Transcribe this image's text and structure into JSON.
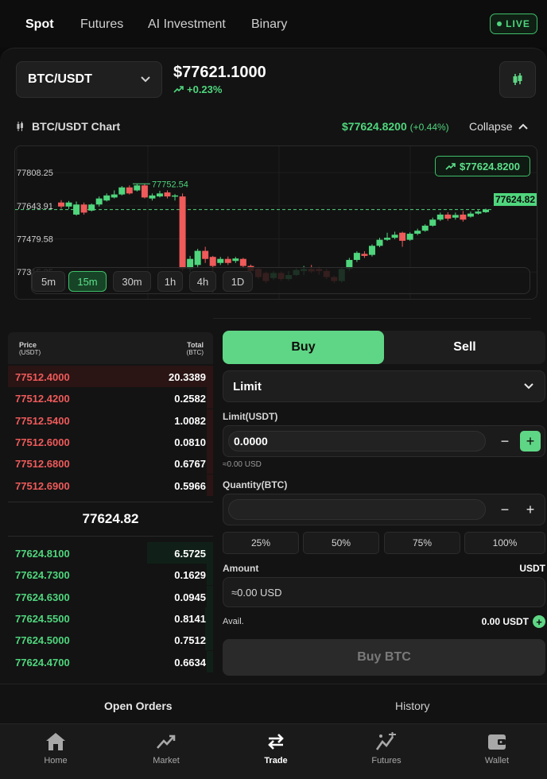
{
  "topnav": {
    "tabs": [
      "Spot",
      "Futures",
      "AI Investment",
      "Binary"
    ],
    "live_label": "LIVE"
  },
  "header": {
    "pair": "BTC/USDT",
    "price": "$77621.1000",
    "change": "+0.23%"
  },
  "chart_section": {
    "title": "BTC/USDT Chart",
    "price": "$77624.8200",
    "change_pct": "(+0.44%)",
    "collapse_label": "Collapse",
    "price_pill": "$77624.8200",
    "last_price_tag": "77624.82",
    "timeframes": [
      "5m",
      "15m",
      "30m",
      "1h",
      "4h",
      "1D"
    ],
    "active_timeframe": "15m"
  },
  "chart_data": {
    "type": "candlestick",
    "y_ticks": [
      "77808.25",
      "77643.91",
      "77479.58",
      "77315.25"
    ],
    "ylim": [
      77150,
      77880
    ],
    "high_annotation": "77752.54",
    "last_price": 77624.82,
    "candles": [
      {
        "o": 77660,
        "c": 77640,
        "h": 77672,
        "l": 77630
      },
      {
        "o": 77640,
        "c": 77660,
        "h": 77668,
        "l": 77628
      },
      {
        "o": 77600,
        "c": 77650,
        "h": 77665,
        "l": 77595
      },
      {
        "o": 77650,
        "c": 77610,
        "h": 77660,
        "l": 77600
      },
      {
        "o": 77620,
        "c": 77650,
        "h": 77655,
        "l": 77615
      },
      {
        "o": 77650,
        "c": 77680,
        "h": 77690,
        "l": 77640
      },
      {
        "o": 77670,
        "c": 77695,
        "h": 77705,
        "l": 77665
      },
      {
        "o": 77685,
        "c": 77700,
        "h": 77720,
        "l": 77680
      },
      {
        "o": 77700,
        "c": 77735,
        "h": 77742,
        "l": 77695
      },
      {
        "o": 77735,
        "c": 77705,
        "h": 77745,
        "l": 77700
      },
      {
        "o": 77720,
        "c": 77745,
        "h": 77752,
        "l": 77715
      },
      {
        "o": 77745,
        "c": 77685,
        "h": 77752,
        "l": 77680
      },
      {
        "o": 77680,
        "c": 77695,
        "h": 77705,
        "l": 77670
      },
      {
        "o": 77690,
        "c": 77705,
        "h": 77718,
        "l": 77685
      },
      {
        "o": 77710,
        "c": 77690,
        "h": 77720,
        "l": 77680
      },
      {
        "o": 77690,
        "c": 77695,
        "h": 77702,
        "l": 77670
      },
      {
        "o": 77690,
        "c": 77330,
        "h": 77705,
        "l": 77320
      },
      {
        "o": 77330,
        "c": 77380,
        "h": 77395,
        "l": 77315
      },
      {
        "o": 77350,
        "c": 77420,
        "h": 77430,
        "l": 77340
      },
      {
        "o": 77420,
        "c": 77380,
        "h": 77440,
        "l": 77360
      },
      {
        "o": 77390,
        "c": 77345,
        "h": 77395,
        "l": 77210
      },
      {
        "o": 77360,
        "c": 77380,
        "h": 77390,
        "l": 77350
      },
      {
        "o": 77380,
        "c": 77360,
        "h": 77392,
        "l": 77350
      },
      {
        "o": 77370,
        "c": 77382,
        "h": 77390,
        "l": 77360
      },
      {
        "o": 77380,
        "c": 77345,
        "h": 77385,
        "l": 77335
      },
      {
        "o": 77345,
        "c": 77320,
        "h": 77352,
        "l": 77310
      },
      {
        "o": 77330,
        "c": 77290,
        "h": 77338,
        "l": 77280
      },
      {
        "o": 77310,
        "c": 77270,
        "h": 77318,
        "l": 77260
      },
      {
        "o": 77285,
        "c": 77310,
        "h": 77320,
        "l": 77275
      },
      {
        "o": 77310,
        "c": 77280,
        "h": 77318,
        "l": 77270
      },
      {
        "o": 77280,
        "c": 77300,
        "h": 77320,
        "l": 77272
      },
      {
        "o": 77300,
        "c": 77325,
        "h": 77335,
        "l": 77295
      },
      {
        "o": 77320,
        "c": 77330,
        "h": 77345,
        "l": 77300
      },
      {
        "o": 77330,
        "c": 77318,
        "h": 77350,
        "l": 77310
      },
      {
        "o": 77330,
        "c": 77320,
        "h": 77340,
        "l": 77300
      },
      {
        "o": 77320,
        "c": 77290,
        "h": 77332,
        "l": 77280
      },
      {
        "o": 77290,
        "c": 77270,
        "h": 77298,
        "l": 77260
      },
      {
        "o": 77270,
        "c": 77330,
        "h": 77338,
        "l": 77262
      },
      {
        "o": 77330,
        "c": 77375,
        "h": 77385,
        "l": 77320
      },
      {
        "o": 77375,
        "c": 77410,
        "h": 77418,
        "l": 77365
      },
      {
        "o": 77405,
        "c": 77395,
        "h": 77418,
        "l": 77385
      },
      {
        "o": 77400,
        "c": 77445,
        "h": 77452,
        "l": 77392
      },
      {
        "o": 77445,
        "c": 77475,
        "h": 77485,
        "l": 77438
      },
      {
        "o": 77475,
        "c": 77485,
        "h": 77510,
        "l": 77470
      },
      {
        "o": 77485,
        "c": 77500,
        "h": 77515,
        "l": 77478
      },
      {
        "o": 77510,
        "c": 77470,
        "h": 77515,
        "l": 77440
      },
      {
        "o": 77475,
        "c": 77505,
        "h": 77512,
        "l": 77470
      },
      {
        "o": 77505,
        "c": 77520,
        "h": 77530,
        "l": 77498
      },
      {
        "o": 77520,
        "c": 77545,
        "h": 77552,
        "l": 77515
      },
      {
        "o": 77545,
        "c": 77575,
        "h": 77585,
        "l": 77540
      },
      {
        "o": 77575,
        "c": 77600,
        "h": 77610,
        "l": 77568
      },
      {
        "o": 77600,
        "c": 77580,
        "h": 77612,
        "l": 77570
      },
      {
        "o": 77585,
        "c": 77598,
        "h": 77610,
        "l": 77575
      },
      {
        "o": 77600,
        "c": 77575,
        "h": 77618,
        "l": 77565
      },
      {
        "o": 77590,
        "c": 77605,
        "h": 77615,
        "l": 77585
      },
      {
        "o": 77605,
        "c": 77615,
        "h": 77622,
        "l": 77600
      },
      {
        "o": 77612,
        "c": 77625,
        "h": 77630,
        "l": 77608
      }
    ]
  },
  "orderbook": {
    "col_price": "Price",
    "col_price_unit": "(USDT)",
    "col_total": "Total",
    "col_total_unit": "(BTC)",
    "asks": [
      {
        "price": "77512.4000",
        "total": "20.3389",
        "depth": 1.0
      },
      {
        "price": "77512.4200",
        "total": "0.2582",
        "depth": 0.03
      },
      {
        "price": "77512.5400",
        "total": "1.0082",
        "depth": 0.03
      },
      {
        "price": "77512.6000",
        "total": "0.0810",
        "depth": 0.03
      },
      {
        "price": "77512.6800",
        "total": "0.6767",
        "depth": 0.03
      },
      {
        "price": "77512.6900",
        "total": "0.5966",
        "depth": 0.03
      }
    ],
    "mid_price": "77624.82",
    "bids": [
      {
        "price": "77624.8100",
        "total": "6.5725",
        "depth": 0.32
      },
      {
        "price": "77624.7300",
        "total": "0.1629",
        "depth": 0.03
      },
      {
        "price": "77624.6300",
        "total": "0.0945",
        "depth": 0.03
      },
      {
        "price": "77624.5500",
        "total": "0.8141",
        "depth": 0.04
      },
      {
        "price": "77624.5000",
        "total": "0.7512",
        "depth": 0.04
      },
      {
        "price": "77624.4700",
        "total": "0.6634",
        "depth": 0.03
      }
    ]
  },
  "form": {
    "buy_label": "Buy",
    "sell_label": "Sell",
    "order_type": "Limit",
    "limit_label": "Limit(USDT)",
    "limit_value": "0.0000",
    "limit_hint": "≈0.00 USD",
    "quantity_label": "Quantity(BTC)",
    "quantity_value": "",
    "percents": [
      "25%",
      "50%",
      "75%",
      "100%"
    ],
    "amount_label": "Amount",
    "amount_unit": "USDT",
    "amount_value": "≈0.00 USD",
    "avail_label": "Avail.",
    "avail_value": "0.00 USDT",
    "submit_label": "Buy BTC"
  },
  "orders_tabs": {
    "open": "Open Orders",
    "history": "History"
  },
  "bottomnav": {
    "items": [
      {
        "label": "Home",
        "icon": "home-icon"
      },
      {
        "label": "Market",
        "icon": "trend-icon"
      },
      {
        "label": "Trade",
        "icon": "swap-icon"
      },
      {
        "label": "Futures",
        "icon": "futures-icon"
      },
      {
        "label": "Wallet",
        "icon": "wallet-icon"
      }
    ],
    "active": "Trade"
  },
  "colors": {
    "accent_green": "#4fd67d",
    "ask_red": "#ef5a5a",
    "background": "#0b0b0b"
  }
}
